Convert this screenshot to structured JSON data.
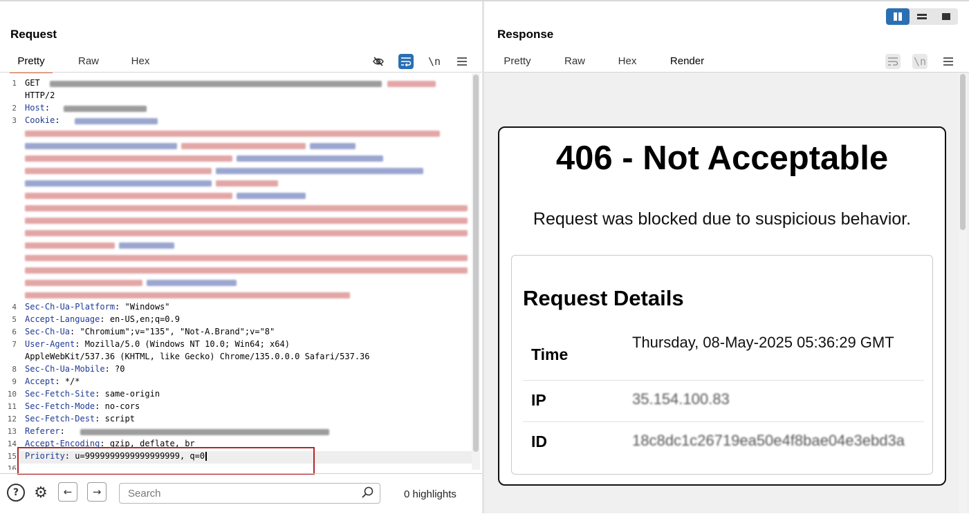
{
  "request": {
    "title": "Request",
    "tabs": [
      "Pretty",
      "Raw",
      "Hex"
    ],
    "toolbar_icons": [
      "eye-off-icon",
      "wrap-lines-icon",
      "newline-icon",
      "menu-icon"
    ],
    "newline_glyph": "\\n",
    "lines": {
      "l1_method": "GET",
      "l1_cont": "HTTP/2",
      "l2_name": "Host",
      "l3_name": "Cookie",
      "l4_name": "Sec-Ch-Ua-Platform",
      "l4_val": "\"Windows\"",
      "l5_name": "Accept-Language",
      "l5_val": "en-US,en;q=0.9",
      "l6_name": "Sec-Ch-Ua",
      "l6_val": "\"Chromium\";v=\"135\", \"Not-A.Brand\";v=\"8\"",
      "l7_name": "User-Agent",
      "l7_val": "Mozilla/5.0 (Windows NT 10.0; Win64; x64)",
      "l7_cont": "AppleWebKit/537.36 (KHTML, like Gecko) Chrome/135.0.0.0 Safari/537.36",
      "l8_name": "Sec-Ch-Ua-Mobile",
      "l8_val": "?0",
      "l9_name": "Accept",
      "l9_val": "*/*",
      "l10_name": "Sec-Fetch-Site",
      "l10_val": "same-origin",
      "l11_name": "Sec-Fetch-Mode",
      "l11_val": "no-cors",
      "l12_name": "Sec-Fetch-Dest",
      "l12_val": "script",
      "l13_name": "Referer",
      "l14_name": "Accept-Encoding",
      "l14_val": "gzip, deflate, br",
      "l15_name": "Priority",
      "l15_val": "u=9999999999999999999, q=0"
    },
    "line_numbers": [
      "1",
      "2",
      "3",
      "4",
      "5",
      "6",
      "7",
      "8",
      "9",
      "10",
      "11",
      "12",
      "13",
      "14",
      "15",
      "16"
    ],
    "search_placeholder": "Search",
    "highlights": "0 highlights",
    "help_glyph": "?",
    "settings_glyph": "⚙",
    "back_glyph": "←",
    "forward_glyph": "→"
  },
  "response": {
    "title": "Response",
    "tabs": [
      "Pretty",
      "Raw",
      "Hex",
      "Render"
    ],
    "active_tab": "Render",
    "toolbar_icons": [
      "wrap-lines-icon",
      "newline-icon",
      "menu-icon"
    ],
    "newline_glyph": "\\n",
    "page": {
      "heading": "406 - Not Acceptable",
      "message": "Request was blocked due to suspicious behavior.",
      "details_title": "Request Details",
      "rows": [
        {
          "key": "Time",
          "value": "Thursday, 08-May-2025 05:36:29 GMT"
        },
        {
          "key": "IP",
          "value": "35.154.100.83"
        },
        {
          "key": "ID",
          "value": "18c8dc1c26719ea50e4f8bae04e3ebd3a"
        }
      ]
    }
  },
  "colors": {
    "accent_orange": "#e8692c",
    "active_blue": "#2a6fb3",
    "highlight_red": "#b02828",
    "header_name_blue": "#1f3a93"
  }
}
